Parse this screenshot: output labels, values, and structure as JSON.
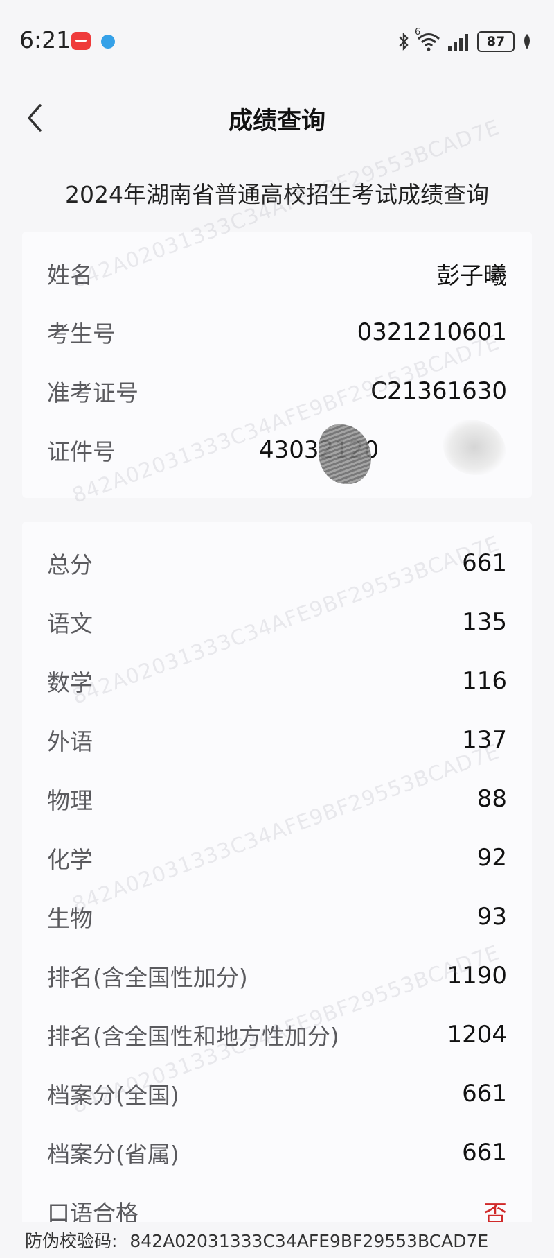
{
  "status_bar": {
    "time": "6:21",
    "network_label": "6",
    "battery": "87",
    "icons": [
      "app-notification-icon",
      "app-browser-icon",
      "bluetooth-icon",
      "wifi-icon",
      "signal-icon",
      "battery-icon",
      "leaf-icon"
    ]
  },
  "nav": {
    "title": "成绩查询",
    "back_icon": "chevron-left-icon"
  },
  "page_title": "2024年湖南省普通高校招生考试成绩查询",
  "info": {
    "name_label": "姓名",
    "name_value": "彭子曦",
    "exam_no_label": "考生号",
    "exam_no_value": "0321210601",
    "admission_label": "准考证号",
    "admission_value": "C21361630",
    "id_label": "证件号",
    "id_value": "43032120"
  },
  "scores": {
    "total_label": "总分",
    "total_value": "661",
    "chinese_label": "语文",
    "chinese_value": "135",
    "math_label": "数学",
    "math_value": "116",
    "foreign_label": "外语",
    "foreign_value": "137",
    "physics_label": "物理",
    "physics_value": "88",
    "chemistry_label": "化学",
    "chemistry_value": "92",
    "biology_label": "生物",
    "biology_value": "93",
    "rank1_label": "排名(含全国性加分)",
    "rank1_value": "1190",
    "rank2_label": "排名(含全国性和地方性加分)",
    "rank2_value": "1204",
    "archive_national_label": "档案分(全国)",
    "archive_national_value": "661",
    "archive_province_label": "档案分(省属)",
    "archive_province_value": "661",
    "oral_label": "口语合格",
    "oral_value": "否"
  },
  "watermark": "842A02031333C34AFE9BF29553BCAD7E",
  "footer": {
    "label": "防伪校验码:",
    "code": "842A02031333C34AFE9BF29553BCAD7E"
  },
  "colors": {
    "background": "#f6f6f8",
    "card": "#fbfbfd",
    "label": "#5a5a5e",
    "value": "#111111",
    "negative": "#d02a2a"
  }
}
